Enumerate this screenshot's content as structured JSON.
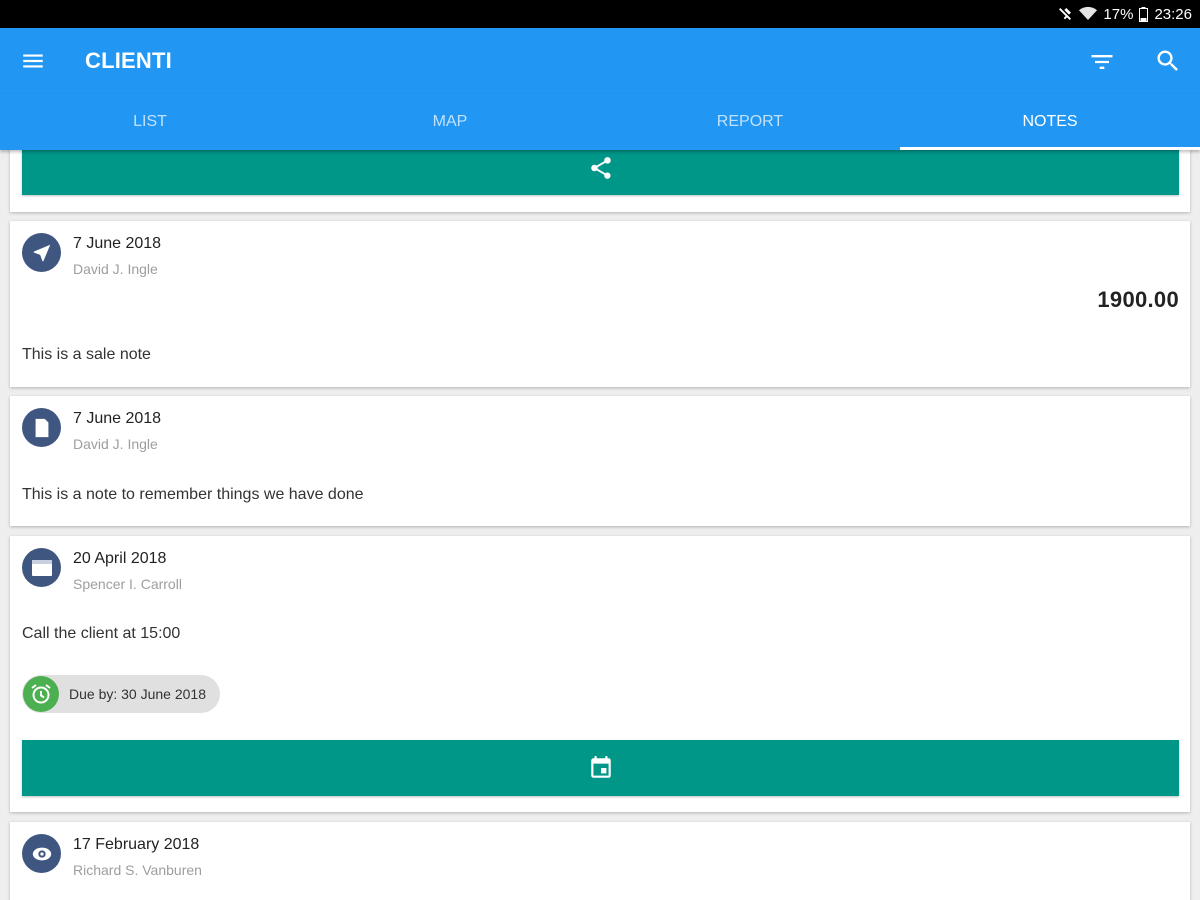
{
  "status_bar": {
    "battery": "17%",
    "time": "23:26"
  },
  "app_bar": {
    "title": "CLIENTI"
  },
  "tabs": [
    {
      "label": "LIST",
      "active": false
    },
    {
      "label": "MAP",
      "active": false
    },
    {
      "label": "REPORT",
      "active": false
    },
    {
      "label": "NOTES",
      "active": true
    }
  ],
  "notes": [
    {
      "date": "7 June 2018",
      "author": "David J. Ingle",
      "amount": "1900.00",
      "text": "This is a sale note",
      "icon": "navigation-arrow-icon"
    },
    {
      "date": "7 June 2018",
      "author": "David J. Ingle",
      "text": "This is a note to remember things we have done",
      "icon": "document-icon"
    },
    {
      "date": "20 April 2018",
      "author": "Spencer I. Carroll",
      "text": "Call the client at 15:00",
      "due": "Due by: 30 June 2018",
      "icon": "calendar-icon"
    },
    {
      "date": "17 February 2018",
      "author": "Richard S. Vanburen",
      "icon": "visit-eye-icon"
    }
  ],
  "colors": {
    "primary": "#2196f3",
    "accent_button": "#009688",
    "avatar": "#3f5780",
    "due_icon": "#4caf50"
  }
}
